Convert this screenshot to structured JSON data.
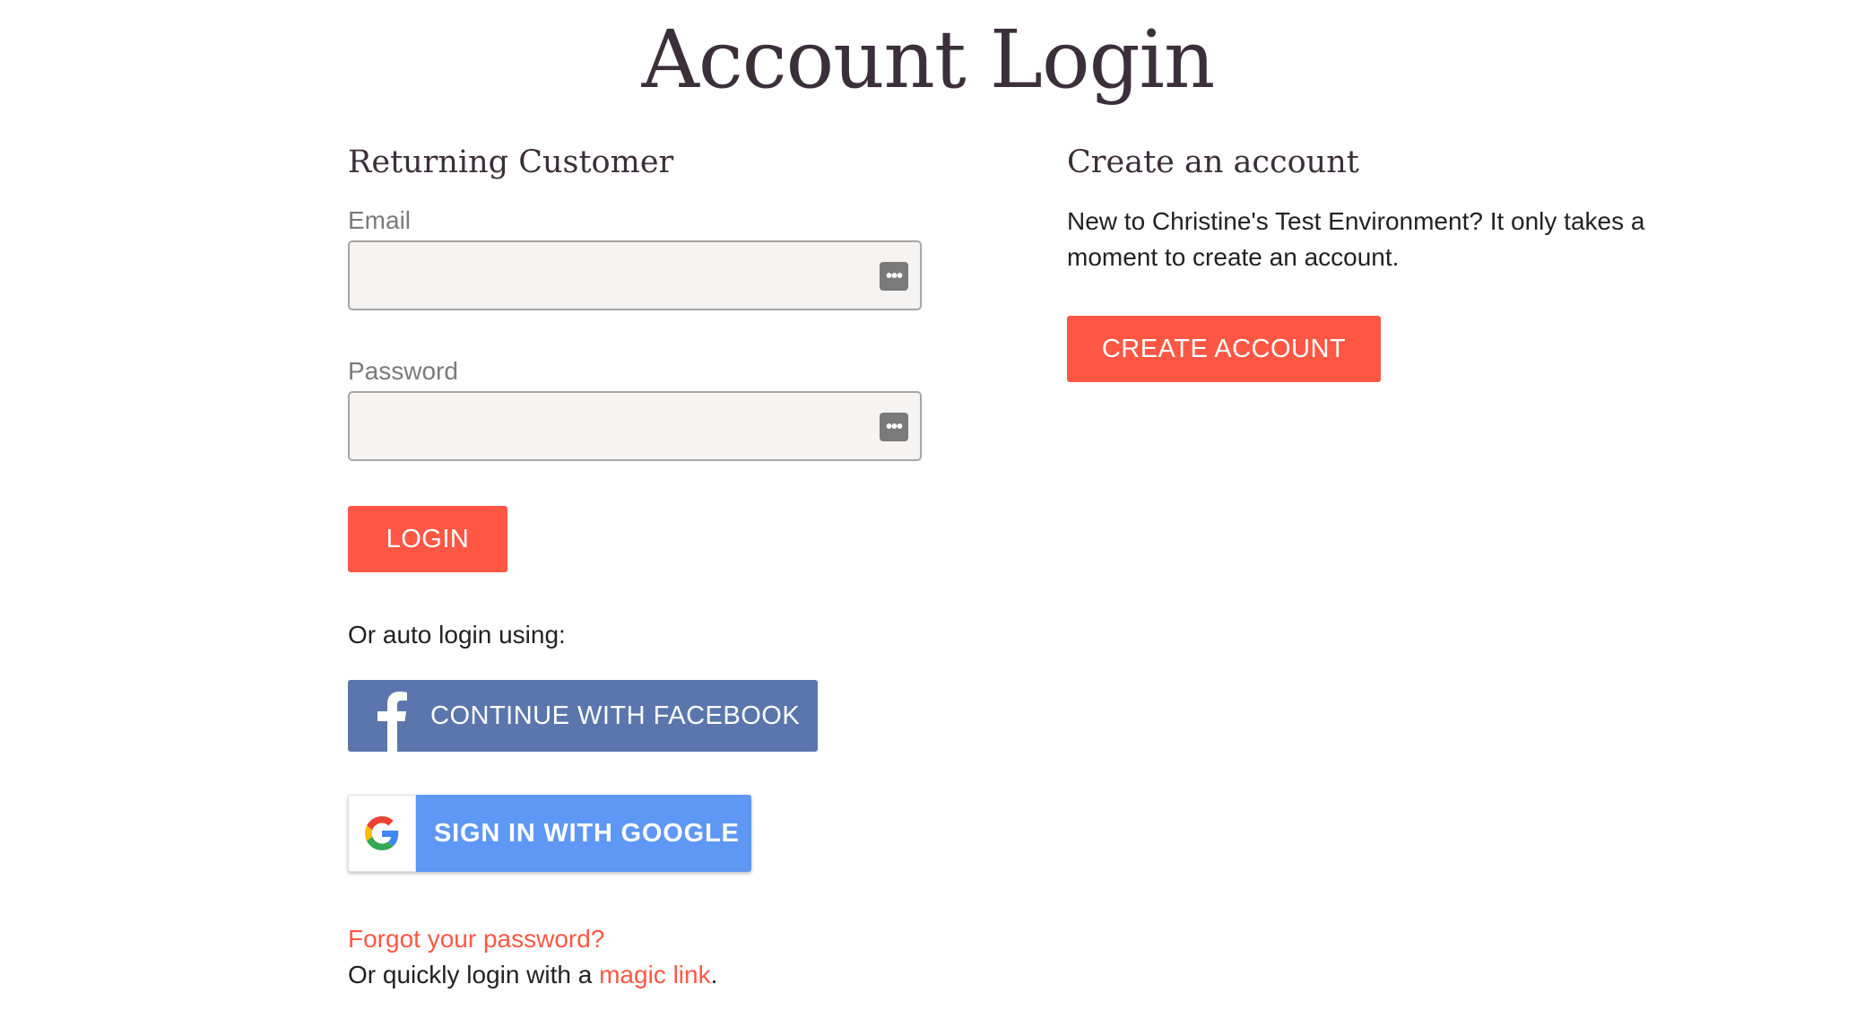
{
  "page": {
    "title": "Account Login"
  },
  "returning": {
    "heading": "Returning Customer",
    "email_label": "Email",
    "email_value": "",
    "email_placeholder": "",
    "password_label": "Password",
    "password_value": "",
    "password_placeholder": "",
    "field_icon": "password-manager-icon",
    "login_label": "LOGIN",
    "auto_login_text": "Or auto login using:",
    "facebook_label": "CONTINUE WITH FACEBOOK",
    "google_label": "SIGN IN WITH GOOGLE",
    "forgot_label": "Forgot your password?",
    "magic_prefix": "Or quickly login with a ",
    "magic_link_label": "magic link",
    "magic_suffix": "."
  },
  "create": {
    "heading": "Create an account",
    "description": "New to Christine's Test Environment? It only takes a moment to create an account.",
    "button_label": "CREATE ACCOUNT"
  },
  "colors": {
    "accent": "#ff5744",
    "facebook": "#5b76ad",
    "google": "#5e97f6",
    "heading": "#3b2f3a",
    "field_bg": "#f6f4f2"
  }
}
